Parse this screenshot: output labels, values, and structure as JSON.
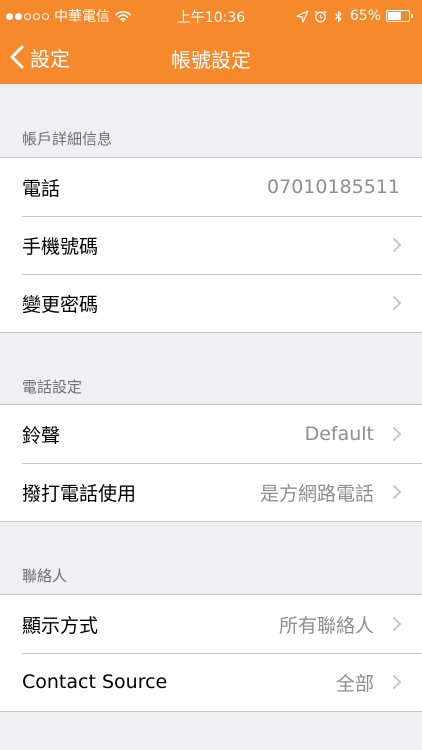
{
  "status_bar": {
    "carrier": "中華電信",
    "time": "上午10:36",
    "battery_percent": "65%",
    "battery_level": 0.65,
    "icons": [
      "signal-dots-icon",
      "wifi-icon",
      "location-arrow-icon",
      "alarm-icon",
      "bluetooth-icon",
      "battery-icon"
    ]
  },
  "nav": {
    "back_label": "設定",
    "title": "帳號設定"
  },
  "colors": {
    "accent": "#f5892b",
    "background": "#efeff4",
    "secondary_text": "#8e8e93",
    "separator": "#c8c7cc"
  },
  "sections": [
    {
      "header": "帳戶詳細信息",
      "rows": [
        {
          "label": "電話",
          "value": "07010185511",
          "chevron": false
        },
        {
          "label": "手機號碼",
          "value": "",
          "chevron": true
        },
        {
          "label": "變更密碼",
          "value": "",
          "chevron": true
        }
      ]
    },
    {
      "header": "電話設定",
      "rows": [
        {
          "label": "鈴聲",
          "value": "Default",
          "chevron": true
        },
        {
          "label": "撥打電話使用",
          "value": "是方網路電話",
          "chevron": true
        }
      ]
    },
    {
      "header": "聯絡人",
      "rows": [
        {
          "label": "顯示方式",
          "value": "所有聯絡人",
          "chevron": true
        },
        {
          "label": "Contact Source",
          "value": "全部",
          "chevron": true
        }
      ]
    }
  ]
}
